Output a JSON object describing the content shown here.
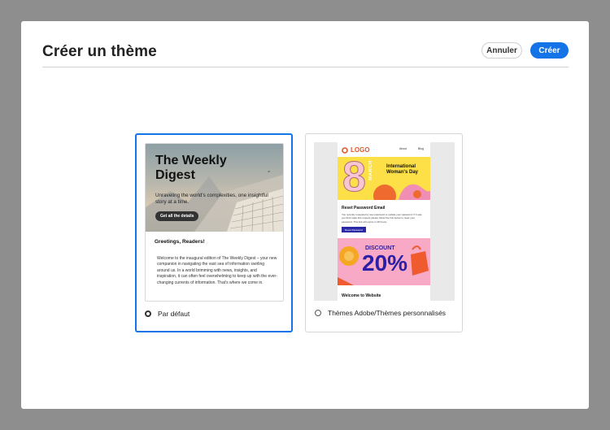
{
  "dialog": {
    "title": "Créer un thème",
    "cancel_label": "Annuler",
    "create_label": "Créer"
  },
  "themes": [
    {
      "label": "Par défaut",
      "selected": true,
      "preview": {
        "hero_title": "The Weekly Digest",
        "hero_subtitle": "Unraveling the world's complexities, one insightful story at a time.",
        "hero_button": "Get all the details",
        "greeting": "Greetings, Readers!",
        "body": "Welcome to the inaugural edition of The Weekly Digest – your new companion in navigating the vast sea of information swirling around us. In a world brimming with news, insights, and inspiration, it can often feel overwhelming to keep up with the ever-changing currents of information. That's where we come in."
      }
    },
    {
      "label": "Thèmes Adobe/Thèmes personnalisés",
      "selected": false,
      "preview": {
        "logo": "LOGO",
        "nav": [
          "About",
          "Blog"
        ],
        "banner_number": "8",
        "banner_month": "MARCH",
        "banner_text": "International Woman's Day",
        "reset_title": "Reset Password Email",
        "reset_body": "You recently requested a new password to update your password. If it was you that made this request please follow the link below to reset your password. This link will expire in 48 hours.",
        "reset_button": "Reset Password",
        "discount_label": "DISCOUNT",
        "discount_value": "20%",
        "welcome": "Welcome to Website"
      }
    }
  ],
  "colors": {
    "accent": "#1473e6",
    "overlay": "#8e8e8e",
    "logo": "#e0572a",
    "banner_yellow": "#fde047",
    "banner_pink": "#f7a9c6",
    "discount_text": "#2b1fa8"
  }
}
